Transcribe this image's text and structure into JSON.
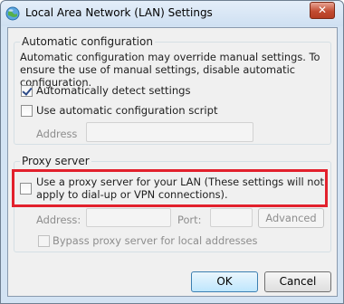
{
  "window": {
    "title": "Local Area Network (LAN) Settings",
    "close_glyph": "✕"
  },
  "automatic": {
    "legend": "Automatic configuration",
    "description": "Automatic configuration may override manual settings.  To ensure the use of manual settings, disable automatic configuration.",
    "auto_detect_label": "Automatically detect settings",
    "auto_detect_checked": true,
    "auto_script_label": "Use automatic configuration script",
    "auto_script_checked": false,
    "address_label": "Address",
    "address_value": ""
  },
  "proxy": {
    "legend": "Proxy server",
    "use_proxy_label": "Use a proxy server for your LAN (These settings will not apply to dial-up or VPN connections).",
    "use_proxy_checked": false,
    "address_label": "Address:",
    "address_value": "",
    "port_label": "Port:",
    "port_value": "",
    "advanced_label": "Advanced",
    "bypass_label": "Bypass proxy server for local addresses",
    "bypass_checked": false
  },
  "footer": {
    "ok_label": "OK",
    "cancel_label": "Cancel"
  },
  "colors": {
    "highlight": "#e2202c"
  },
  "icons": {
    "app": "network-globe-icon",
    "close": "close-icon",
    "checkmark": "checkmark-icon"
  }
}
